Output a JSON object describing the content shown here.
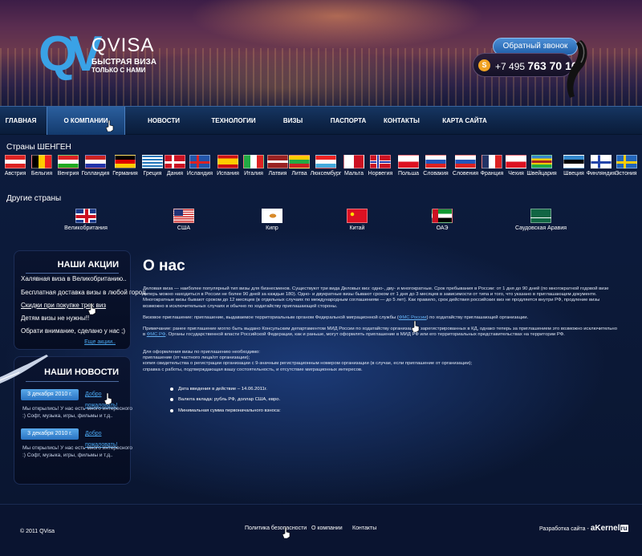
{
  "header": {
    "logo_name": "QVISA",
    "logo_tag1": "БЫСТРАЯ ВИЗА",
    "logo_tag2": "ТОЛЬКО С НАМИ",
    "callback_label": "Обратный звонок",
    "phone_prefix": "+7 495",
    "phone_main": "763 70 16"
  },
  "nav": {
    "items": [
      {
        "label": "ГЛАВНАЯ"
      },
      {
        "label": "О КОМПАНИИ"
      },
      {
        "label": "НОВОСТИ"
      },
      {
        "label": "ТЕХНОЛОГИИ"
      },
      {
        "label": "ВИЗЫ"
      },
      {
        "label": "ПАСПОРТА"
      },
      {
        "label": "КОНТАКТЫ"
      },
      {
        "label": "КАРТА САЙТА"
      }
    ]
  },
  "schengen": {
    "heading": "Страны ШЕНГЕН",
    "countries": [
      {
        "label": "Австрия"
      },
      {
        "label": "Бельгия"
      },
      {
        "label": "Венгрия"
      },
      {
        "label": "Голландия"
      },
      {
        "label": "Германия"
      },
      {
        "label": "Греция"
      },
      {
        "label": "Дания"
      },
      {
        "label": "Исландия"
      },
      {
        "label": "Испания"
      },
      {
        "label": "Италия"
      },
      {
        "label": "Латвия"
      },
      {
        "label": "Литва"
      },
      {
        "label": "Люксембург"
      },
      {
        "label": "Мальта"
      },
      {
        "label": "Норвегия"
      },
      {
        "label": "Польша"
      },
      {
        "label": "Словакия"
      },
      {
        "label": "Словения"
      },
      {
        "label": "Франция"
      },
      {
        "label": "Чехия"
      },
      {
        "label": "Швейцария"
      },
      {
        "label": "Швеция"
      },
      {
        "label": "Финляндия"
      },
      {
        "label": "Эстония"
      }
    ]
  },
  "other": {
    "heading": "Другие страны",
    "countries": [
      {
        "label": "Великобритания"
      },
      {
        "label": "США"
      },
      {
        "label": "Кипр"
      },
      {
        "label": "Китай"
      },
      {
        "label": "ОАЭ"
      },
      {
        "label": "Саудовская Аравия"
      }
    ]
  },
  "promos": {
    "title": "НАШИ АКЦИИ",
    "items": [
      "Халявная виза в Великобританию..",
      "Бесплатная доставка визы в любой город.",
      "Скидки при покупке трех виз",
      "Детям визы не нужны!!",
      "Обрати внимание, сделано у нас ;)"
    ],
    "more": "Еще акции.."
  },
  "news": {
    "title": "НАШИ НОВОСТИ",
    "items": [
      {
        "date": "3 декабря 2010 г.",
        "link": "Добро пожаловать!",
        "text": "Мы открылись! У нас есть много интересного :) Софт, музыка, игры, фильмы и т.д.."
      },
      {
        "date": "3 декабря 2010 г.",
        "link": "Добро пожаловать!",
        "text": "Мы открылись! У нас есть много интересного :) Софт, музыка, игры, фильмы и т.д.."
      }
    ]
  },
  "content": {
    "title": "О нас",
    "p1": "Деловая виза — наиболее популярный тип визы для бизнесменов. Существуют три вида Деловых виз: одно-, дву- и многократные. Срок пребывания в России: от 1 дня до 90 дней (по многократной годовой визе теперь можно находиться в России не более 90 дней за каждые 180). Одно- и двукратные визы бывают сроком от 1 дня до 3 месяцев в зависимости от типа и того, что указано в приглашающем документе. Многократные визы бывают сроком до 12 месяцев (в отдельных случаях по международным соглашениям — до 5 лет). Как правило, срок действия российских виз не продляется внутри РФ, продление визы возможно в исключительных случаях и обычно по ходатайству приглашающей стороны.",
    "p2_a": "Визовое приглашение: приглашение, выдаваемое территориальным органом Федеральной миграционной службы (",
    "p2_link": "ФМС России",
    "p2_b": ") по ходатайству приглашающей организации.",
    "p3_a": "Примечание: ранее приглашение могло быть выдано Консульским департаментом МИД России по ходатайству организации, зарегистрированных в КД, однако теперь за приглашением это возможно исключительно в ",
    "p3_link": "ФМС РФ",
    "p3_b": ". Органы государственной власти Российской Федерации, как и раньше, могут оформлять приглашение в МИД РФ или его территориальных представительствах на территории РФ.",
    "p4": "Для оформления визы по приглашению необходимо:",
    "p4_l1": "приглашение (от частного лица/от организации);",
    "p4_l2": "копия свидетельства о регистрации организации с 9-значным регистрационным номером организации (в случае, если приглашение от организации);",
    "p4_l3": "справка с работы, подтверждающая вашу состоятельность, и отсутствие миграционных интересов.",
    "bullets": [
      "Дата введения в действие – 14.06.2011г.",
      "Валюта вклада: рубль РФ, доллар США, евро.",
      "Минимальная сумма первоначального взноса:"
    ]
  },
  "footer": {
    "copyright": "© 2011 QVisa",
    "links": [
      "Политика безопасности",
      "О компании",
      "Контакты"
    ],
    "dev_label": "Разработка сайта -",
    "dev_name_a": "aKernel",
    "dev_name_b": "ru"
  },
  "colors": {
    "accent": "#3aa2e6",
    "link": "#4aa7f0",
    "background": "#0b1733"
  }
}
